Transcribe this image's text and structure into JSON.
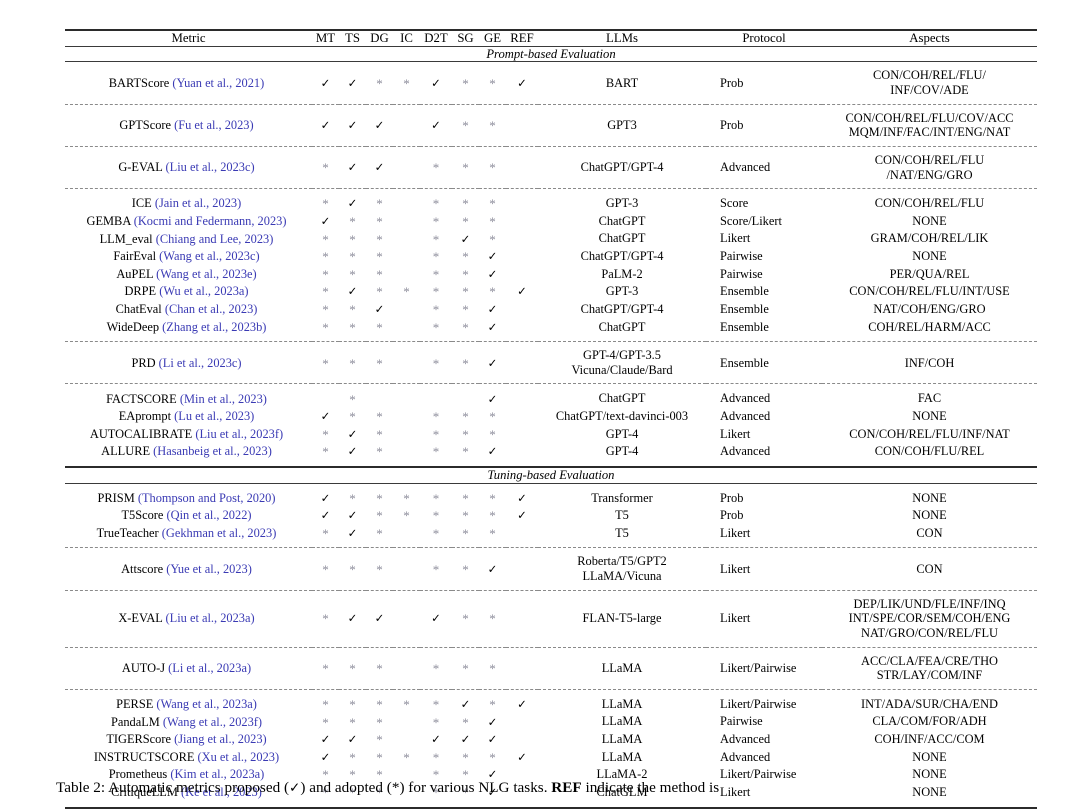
{
  "table": {
    "columns": [
      "Metric",
      "MT",
      "TS",
      "DG",
      "IC",
      "D2T",
      "SG",
      "GE",
      "REF",
      "LLMs",
      "Protocol",
      "Aspects"
    ],
    "symbols": {
      "proposed": "✓",
      "adopted": "*",
      "blank": ""
    },
    "citation_color": "#3a3ab4",
    "sections": [
      {
        "label": "Prompt-based Evaluation",
        "groups": [
          {
            "rows": [
              {
                "metric": "BARTScore",
                "cite": "(Yuan et al., 2021)",
                "marks": [
                  "✓",
                  "✓",
                  "*",
                  "*",
                  "✓",
                  "*",
                  "*",
                  "✓"
                ],
                "llm": "BART",
                "protocol": "Prob",
                "aspects": "CON/COH/REL/FLU/\nINF/COV/ADE"
              }
            ]
          },
          {
            "rows": [
              {
                "metric": "GPTScore",
                "cite": "(Fu et al., 2023)",
                "marks": [
                  "✓",
                  "✓",
                  "✓",
                  "",
                  "✓",
                  "*",
                  "*",
                  ""
                ],
                "llm": "GPT3",
                "protocol": "Prob",
                "aspects": "CON/COH/REL/FLU/COV/ACC\nMQM/INF/FAC/INT/ENG/NAT"
              }
            ]
          },
          {
            "rows": [
              {
                "metric": "G-EVAL",
                "cite": "(Liu et al., 2023c)",
                "marks": [
                  "*",
                  "✓",
                  "✓",
                  "",
                  "*",
                  "*",
                  "*",
                  ""
                ],
                "llm": "ChatGPT/GPT-4",
                "protocol": "Advanced",
                "aspects": "CON/COH/REL/FLU\n/NAT/ENG/GRO"
              }
            ]
          },
          {
            "rows": [
              {
                "metric": "ICE",
                "cite": "(Jain et al., 2023)",
                "marks": [
                  "*",
                  "✓",
                  "*",
                  "",
                  "*",
                  "*",
                  "*",
                  ""
                ],
                "llm": "GPT-3",
                "protocol": "Score",
                "aspects": "CON/COH/REL/FLU"
              },
              {
                "metric": "GEMBA",
                "cite": "(Kocmi and Federmann, 2023)",
                "marks": [
                  "✓",
                  "*",
                  "*",
                  "",
                  "*",
                  "*",
                  "*",
                  ""
                ],
                "llm": "ChatGPT",
                "protocol": "Score/Likert",
                "aspects": "NONE"
              },
              {
                "metric": "LLM_eval",
                "cite": "(Chiang and Lee, 2023)",
                "marks": [
                  "*",
                  "*",
                  "*",
                  "",
                  "*",
                  "✓",
                  "*",
                  ""
                ],
                "llm": "ChatGPT",
                "protocol": "Likert",
                "aspects": "GRAM/COH/REL/LIK"
              },
              {
                "metric": "FairEval",
                "cite": "(Wang et al., 2023c)",
                "marks": [
                  "*",
                  "*",
                  "*",
                  "",
                  "*",
                  "*",
                  "✓",
                  ""
                ],
                "llm": "ChatGPT/GPT-4",
                "protocol": "Pairwise",
                "aspects": "NONE"
              },
              {
                "metric": "AuPEL",
                "cite": "(Wang et al., 2023e)",
                "marks": [
                  "*",
                  "*",
                  "*",
                  "",
                  "*",
                  "*",
                  "✓",
                  ""
                ],
                "llm": "PaLM-2",
                "protocol": "Pairwise",
                "aspects": "PER/QUA/REL"
              },
              {
                "metric": "DRPE",
                "cite": "(Wu et al., 2023a)",
                "marks": [
                  "*",
                  "✓",
                  "*",
                  "*",
                  "*",
                  "*",
                  "*",
                  "✓"
                ],
                "llm": "GPT-3",
                "protocol": "Ensemble",
                "aspects": "CON/COH/REL/FLU/INT/USE"
              },
              {
                "metric": "ChatEval",
                "cite": "(Chan et al., 2023)",
                "marks": [
                  "*",
                  "*",
                  "✓",
                  "",
                  "*",
                  "*",
                  "✓",
                  ""
                ],
                "llm": "ChatGPT/GPT-4",
                "protocol": "Ensemble",
                "aspects": "NAT/COH/ENG/GRO"
              },
              {
                "metric": "WideDeep",
                "cite": "(Zhang et al., 2023b)",
                "marks": [
                  "*",
                  "*",
                  "*",
                  "",
                  "*",
                  "*",
                  "✓",
                  ""
                ],
                "llm": "ChatGPT",
                "protocol": "Ensemble",
                "aspects": "COH/REL/HARM/ACC"
              }
            ]
          },
          {
            "rows": [
              {
                "metric": "PRD",
                "cite": "(Li et al., 2023c)",
                "marks": [
                  "*",
                  "*",
                  "*",
                  "",
                  "*",
                  "*",
                  "✓",
                  ""
                ],
                "llm": "GPT-4/GPT-3.5\nVicuna/Claude/Bard",
                "protocol": "Ensemble",
                "aspects": "INF/COH"
              }
            ]
          },
          {
            "rows": [
              {
                "metric": "FACTSCORE",
                "cite": "(Min et al., 2023)",
                "marks": [
                  "",
                  "*",
                  "",
                  "",
                  "",
                  "",
                  "✓",
                  ""
                ],
                "llm": "ChatGPT",
                "protocol": "Advanced",
                "aspects": "FAC"
              },
              {
                "metric": "EAprompt",
                "cite": "(Lu et al., 2023)",
                "marks": [
                  "✓",
                  "*",
                  "*",
                  "",
                  "*",
                  "*",
                  "*",
                  ""
                ],
                "llm": "ChatGPT/text-davinci-003",
                "protocol": "Advanced",
                "aspects": "NONE"
              },
              {
                "metric": "AUTOCALIBRATE",
                "cite": "(Liu et al., 2023f)",
                "marks": [
                  "*",
                  "✓",
                  "*",
                  "",
                  "*",
                  "*",
                  "*",
                  ""
                ],
                "llm": "GPT-4",
                "protocol": "Likert",
                "aspects": "CON/COH/REL/FLU/INF/NAT"
              },
              {
                "metric": "ALLURE",
                "cite": "(Hasanbeig et al., 2023)",
                "marks": [
                  "*",
                  "✓",
                  "*",
                  "",
                  "*",
                  "*",
                  "✓",
                  ""
                ],
                "llm": "GPT-4",
                "protocol": "Advanced",
                "aspects": "CON/COH/FLU/REL"
              }
            ]
          }
        ]
      },
      {
        "label": "Tuning-based Evaluation",
        "groups": [
          {
            "rows": [
              {
                "metric": "PRISM",
                "cite": "(Thompson and Post, 2020)",
                "marks": [
                  "✓",
                  "*",
                  "*",
                  "*",
                  "*",
                  "*",
                  "*",
                  "✓"
                ],
                "llm": "Transformer",
                "protocol": "Prob",
                "aspects": "NONE"
              },
              {
                "metric": "T5Score",
                "cite": "(Qin et al., 2022)",
                "marks": [
                  "✓",
                  "✓",
                  "*",
                  "*",
                  "*",
                  "*",
                  "*",
                  "✓"
                ],
                "llm": "T5",
                "protocol": "Prob",
                "aspects": "NONE"
              },
              {
                "metric": "TrueTeacher",
                "cite": "(Gekhman et al., 2023)",
                "marks": [
                  "*",
                  "✓",
                  "*",
                  "",
                  "*",
                  "*",
                  "*",
                  ""
                ],
                "llm": "T5",
                "protocol": "Likert",
                "aspects": "CON"
              }
            ]
          },
          {
            "rows": [
              {
                "metric": "Attscore",
                "cite": "(Yue et al., 2023)",
                "marks": [
                  "*",
                  "*",
                  "*",
                  "",
                  "*",
                  "*",
                  "✓",
                  ""
                ],
                "llm": "Roberta/T5/GPT2\nLLaMA/Vicuna",
                "protocol": "Likert",
                "aspects": "CON"
              }
            ]
          },
          {
            "rows": [
              {
                "metric": "X-EVAL",
                "cite": "(Liu et al., 2023a)",
                "marks": [
                  "*",
                  "✓",
                  "✓",
                  "",
                  "✓",
                  "*",
                  "*",
                  ""
                ],
                "llm": "FLAN-T5-large",
                "protocol": "Likert",
                "aspects": "DEP/LIK/UND/FLE/INF/INQ\nINT/SPE/COR/SEM/COH/ENG\nNAT/GRO/CON/REL/FLU"
              }
            ]
          },
          {
            "rows": [
              {
                "metric": "AUTO-J",
                "cite": "(Li et al., 2023a)",
                "marks": [
                  "*",
                  "*",
                  "*",
                  "",
                  "*",
                  "*",
                  "*",
                  ""
                ],
                "llm": "LLaMA",
                "protocol": "Likert/Pairwise",
                "aspects": "ACC/CLA/FEA/CRE/THO\nSTR/LAY/COM/INF"
              }
            ]
          },
          {
            "rows": [
              {
                "metric": "PERSE",
                "cite": "(Wang et al., 2023a)",
                "marks": [
                  "*",
                  "*",
                  "*",
                  "*",
                  "*",
                  "✓",
                  "*",
                  "✓"
                ],
                "llm": "LLaMA",
                "protocol": "Likert/Pairwise",
                "aspects": "INT/ADA/SUR/CHA/END"
              },
              {
                "metric": "PandaLM",
                "cite": "(Wang et al., 2023f)",
                "marks": [
                  "*",
                  "*",
                  "*",
                  "",
                  "*",
                  "*",
                  "✓",
                  ""
                ],
                "llm": "LLaMA",
                "protocol": "Pairwise",
                "aspects": "CLA/COM/FOR/ADH"
              },
              {
                "metric": "TIGERScore",
                "cite": "(Jiang et al., 2023)",
                "marks": [
                  "✓",
                  "✓",
                  "*",
                  "",
                  "✓",
                  "✓",
                  "✓",
                  ""
                ],
                "llm": "LLaMA",
                "protocol": "Advanced",
                "aspects": "COH/INF/ACC/COM"
              },
              {
                "metric": "INSTRUCTSCORE",
                "cite": "(Xu et al., 2023)",
                "marks": [
                  "✓",
                  "*",
                  "*",
                  "*",
                  "*",
                  "*",
                  "*",
                  "✓"
                ],
                "llm": "LLaMA",
                "protocol": "Advanced",
                "aspects": "NONE"
              },
              {
                "metric": "Prometheus",
                "cite": "(Kim et al., 2023a)",
                "marks": [
                  "*",
                  "*",
                  "*",
                  "",
                  "*",
                  "*",
                  "✓",
                  ""
                ],
                "llm": "LLaMA-2",
                "protocol": "Likert/Pairwise",
                "aspects": "NONE"
              },
              {
                "metric": "CritiqueLLM",
                "cite": "(Ke et al., 2023)",
                "marks": [
                  "*",
                  "*",
                  "*",
                  "",
                  "*",
                  "*",
                  "✓",
                  ""
                ],
                "llm": "ChatGLM",
                "protocol": "Likert",
                "aspects": "NONE"
              }
            ]
          }
        ]
      }
    ]
  },
  "caption": {
    "prefix": "Table 2: Automatic metrics proposed (",
    "check": "✓",
    "mid": ") and adopted (*) for various NLG tasks. ",
    "bold": "REF",
    "suffix": " indicate the method is"
  }
}
